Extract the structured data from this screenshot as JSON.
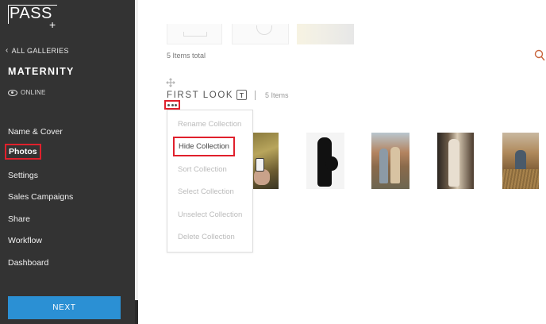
{
  "logo": {
    "text": "PASS",
    "plus": "+"
  },
  "sidebar": {
    "back_label": "ALL GALLERIES",
    "gallery_name": "MATERNITY",
    "status": "ONLINE",
    "nav": [
      {
        "label": "Name & Cover"
      },
      {
        "label": "Photos"
      },
      {
        "label": "Settings"
      },
      {
        "label": "Sales Campaigns"
      },
      {
        "label": "Share"
      },
      {
        "label": "Workflow"
      },
      {
        "label": "Dashboard"
      }
    ],
    "next_label": "NEXT"
  },
  "main": {
    "items_total": "5 Items total",
    "collection": {
      "title": "FIRST LOOK",
      "type_icon": "T",
      "count": "5 Items"
    },
    "menu": [
      {
        "label": "Rename Collection"
      },
      {
        "label": "Hide Collection"
      },
      {
        "label": "Sort Collection"
      },
      {
        "label": "Select Collection"
      },
      {
        "label": "Unselect Collection"
      },
      {
        "label": "Delete Collection"
      }
    ]
  },
  "colors": {
    "sidebar_bg": "#333333",
    "accent_blue": "#2b90d4",
    "highlight_red": "#e0202c"
  },
  "icons": [
    "chevron-left-icon",
    "eye-icon",
    "search-icon",
    "move-icon",
    "text-type-icon",
    "more-dots-icon"
  ]
}
